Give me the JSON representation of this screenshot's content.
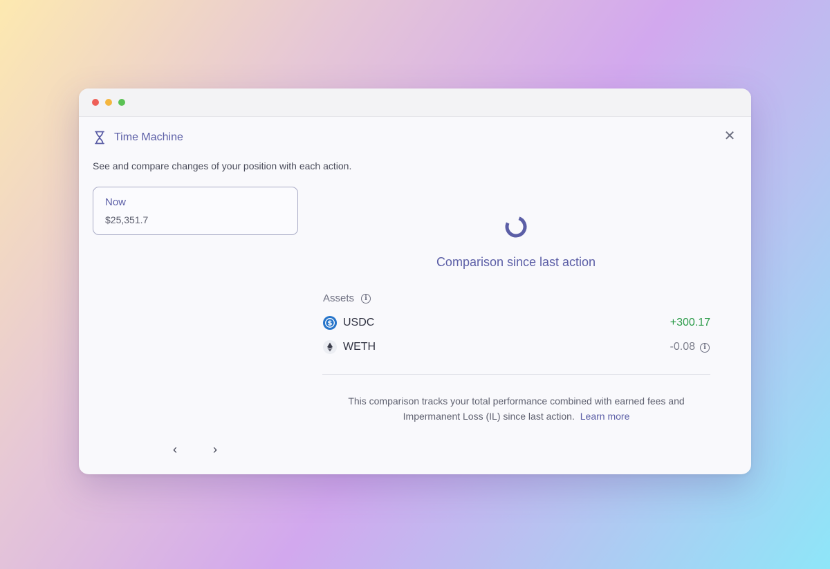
{
  "window": {
    "title": "Time Machine",
    "subtitle": "See and compare changes of your position with each action.",
    "close_symbol": "✕"
  },
  "snapshot_card": {
    "label": "Now",
    "value": "$25,351.7"
  },
  "pagination": {
    "prev_symbol": "‹",
    "next_symbol": "›"
  },
  "comparison": {
    "title": "Comparison since last action",
    "assets_label": "Assets",
    "assets": [
      {
        "symbol": "USDC",
        "change": "+300.17",
        "icon": "usdc-icon",
        "trend": "positive"
      },
      {
        "symbol": "WETH",
        "change": "-0.08",
        "icon": "eth-icon",
        "trend": "negative"
      }
    ],
    "footnote": "This comparison tracks your total performance combined with earned fees and Impermanent Loss (IL) since last action.",
    "learn_more": "Learn more"
  },
  "colors": {
    "accent": "#5b5ea6",
    "positive": "#2a9a47",
    "muted": "#7b7d8a",
    "usdc": "#2775ca"
  }
}
